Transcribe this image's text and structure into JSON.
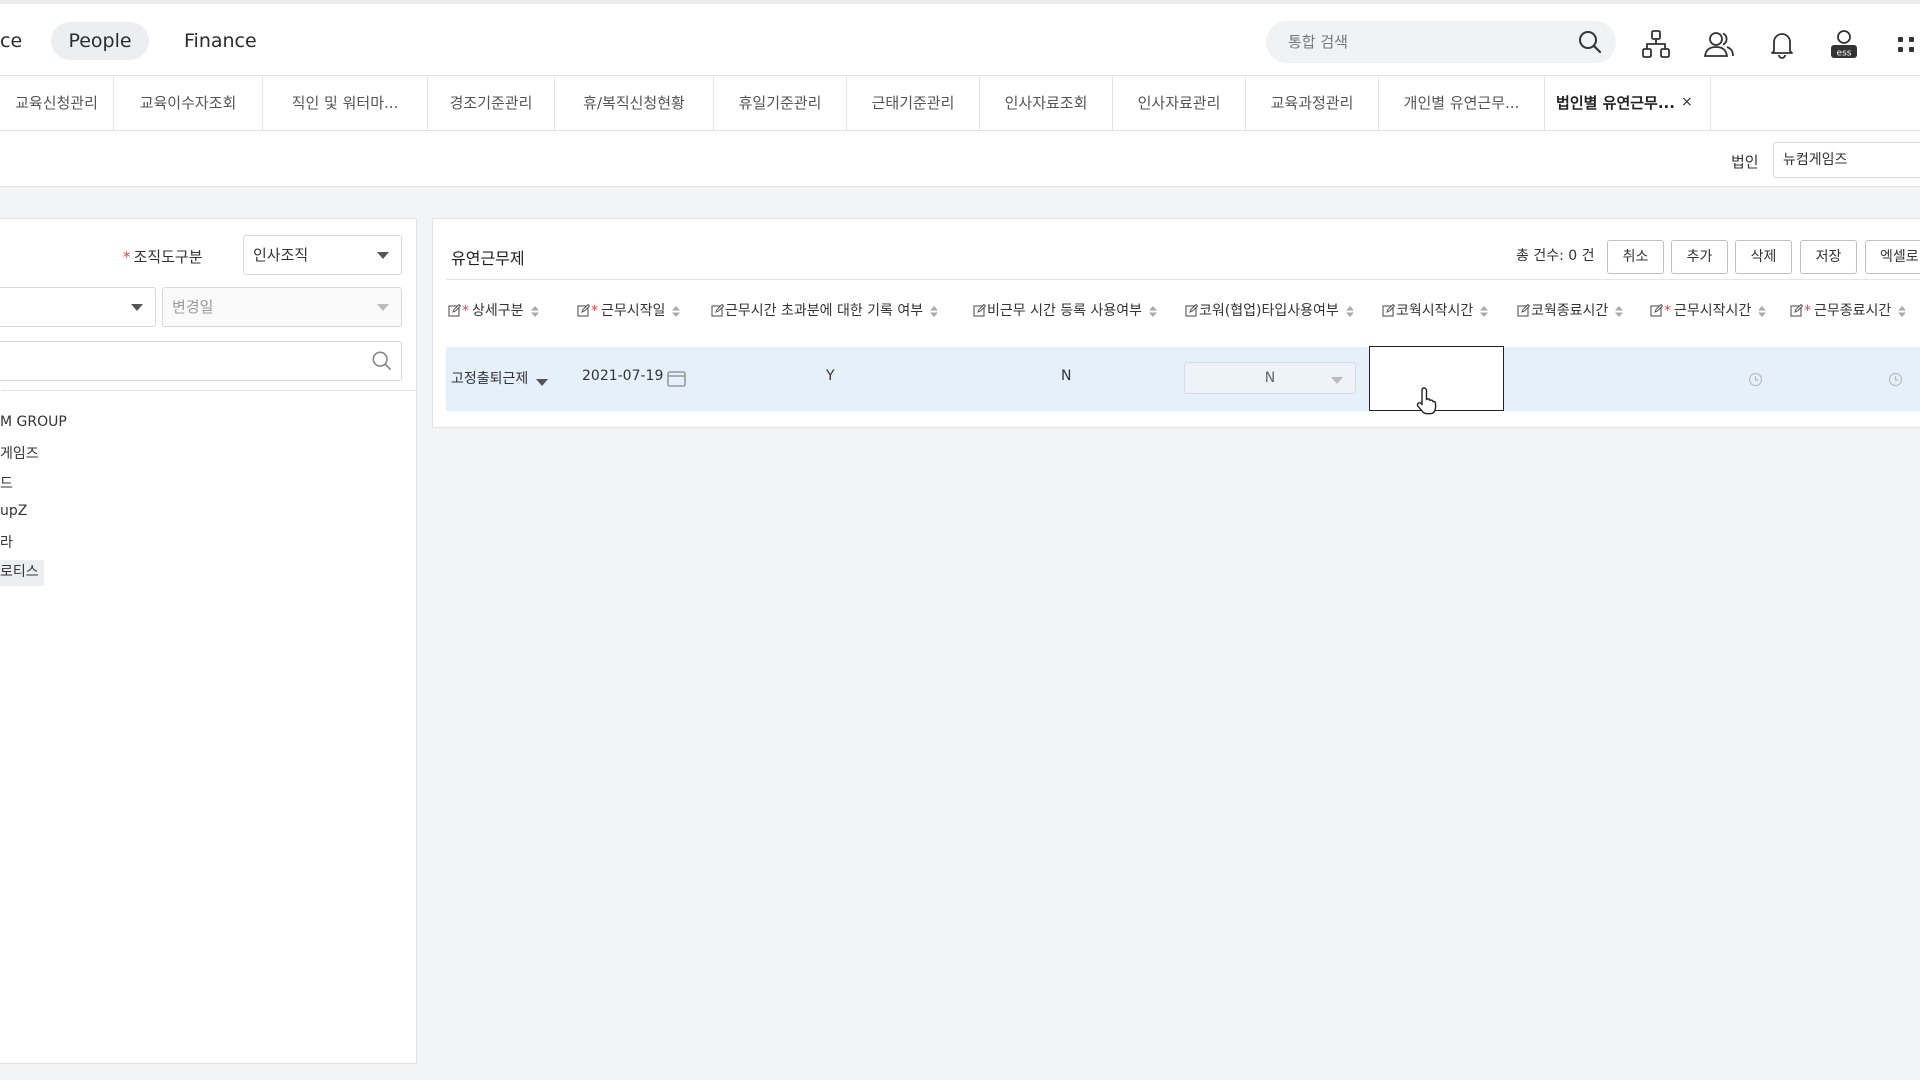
{
  "topnav": {
    "items": [
      {
        "label": "ce"
      },
      {
        "label": "People"
      },
      {
        "label": "Finance"
      }
    ],
    "search_placeholder": "통합 검색",
    "header_icons": [
      "org-chart-icon",
      "users-icon",
      "bell-icon",
      "ess-profile-icon",
      "apps-grid-icon"
    ],
    "ess_text": "ess"
  },
  "tabs": [
    {
      "label": "교육신청관리"
    },
    {
      "label": "교육이수자조회"
    },
    {
      "label": "직인 및 워터마..."
    },
    {
      "label": "경조기준관리"
    },
    {
      "label": "휴/복직신청현황"
    },
    {
      "label": "휴일기준관리"
    },
    {
      "label": "근태기준관리"
    },
    {
      "label": "인사자료조회"
    },
    {
      "label": "인사자료관리"
    },
    {
      "label": "교육과정관리"
    },
    {
      "label": "개인별 유연근무..."
    },
    {
      "label": "법인별 유연근무...",
      "active": true
    }
  ],
  "tab_close": "×",
  "filter": {
    "corp_label": "법인",
    "corp_value": "뉴컴게임즈"
  },
  "left_panel": {
    "org_type_label": "조직도구분",
    "required_mark": "*",
    "org_type_value": "인사조직",
    "change_date_placeholder": "변경일",
    "tree": [
      "M GROUP",
      "게임즈",
      "드",
      "upZ",
      "라",
      "로티스"
    ]
  },
  "main": {
    "title": "유연근무제",
    "count_text": "총 건수: 0 건",
    "buttons": [
      "취소",
      "추가",
      "삭제",
      "저장",
      "엑셀로"
    ],
    "columns": [
      {
        "label": "상세구분",
        "required": true
      },
      {
        "label": "근무시작일",
        "required": true
      },
      {
        "label": "근무시간 초과분에 대한 기록 여부",
        "required": false
      },
      {
        "label": "비근무 시간 등록 사용여부",
        "required": false
      },
      {
        "label": "코워(협업)타입사용여부",
        "required": false
      },
      {
        "label": "코웍시작시간",
        "required": false
      },
      {
        "label": "코웍종료시간",
        "required": false
      },
      {
        "label": "근무시작시간",
        "required": true
      },
      {
        "label": "근무종료시간",
        "required": true
      }
    ],
    "row": {
      "detail_type": "고정출퇴근제",
      "start_date": "2021-07-19",
      "overtime_record": "Y",
      "nonwork_register": "N",
      "cowork_type": "N",
      "cowork_start": "",
      "cowork_end": ""
    }
  },
  "colors": {
    "accent_required": "#e04848",
    "row_selected": "#e6f0fb",
    "active_nav_bg": "#eceef1"
  }
}
